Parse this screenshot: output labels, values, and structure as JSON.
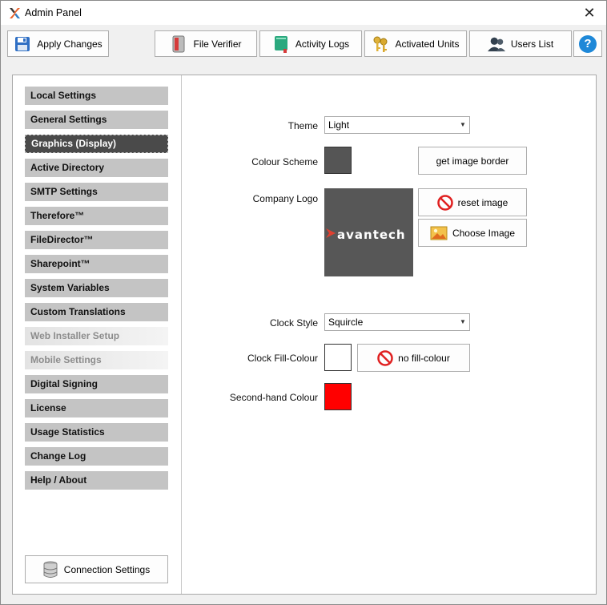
{
  "window": {
    "title": "Admin Panel",
    "close_glyph": "✕"
  },
  "toolbar": {
    "apply": "Apply Changes",
    "file_verifier": "File Verifier",
    "activity_logs": "Activity Logs",
    "activated_units": "Activated Units",
    "users_list": "Users List",
    "help": "?"
  },
  "sidebar": {
    "items": [
      {
        "label": "Local Settings",
        "state": "normal"
      },
      {
        "label": "General Settings",
        "state": "normal"
      },
      {
        "label": "Graphics (Display)",
        "state": "active"
      },
      {
        "label": "Active Directory",
        "state": "normal"
      },
      {
        "label": "SMTP Settings",
        "state": "normal"
      },
      {
        "label": "Therefore™",
        "state": "normal"
      },
      {
        "label": "FileDirector™",
        "state": "normal"
      },
      {
        "label": "Sharepoint™",
        "state": "normal"
      },
      {
        "label": "System Variables",
        "state": "normal"
      },
      {
        "label": "Custom Translations",
        "state": "normal"
      },
      {
        "label": "Web Installer Setup",
        "state": "disabled"
      },
      {
        "label": "Mobile Settings",
        "state": "disabled"
      },
      {
        "label": "Digital Signing",
        "state": "normal"
      },
      {
        "label": "License",
        "state": "normal"
      },
      {
        "label": "Usage Statistics",
        "state": "normal"
      },
      {
        "label": "Change Log",
        "state": "normal"
      },
      {
        "label": "Help / About",
        "state": "normal"
      }
    ],
    "connection_settings": "Connection Settings"
  },
  "graphics": {
    "theme_label": "Theme",
    "theme_value": "Light",
    "colour_scheme_label": "Colour Scheme",
    "colour_scheme_color": "#555555",
    "get_image_border": "get image border",
    "company_logo_label": "Company Logo",
    "logo_text": "avantech",
    "reset_image": "reset image",
    "choose_image": "Choose Image",
    "clock_style_label": "Clock Style",
    "clock_style_value": "Squircle",
    "clock_fill_label": "Clock Fill-Colour",
    "clock_fill_color": "#ffffff",
    "no_fill_colour": "no fill-colour",
    "second_hand_label": "Second-hand Colour",
    "second_hand_color": "#ff0000"
  }
}
